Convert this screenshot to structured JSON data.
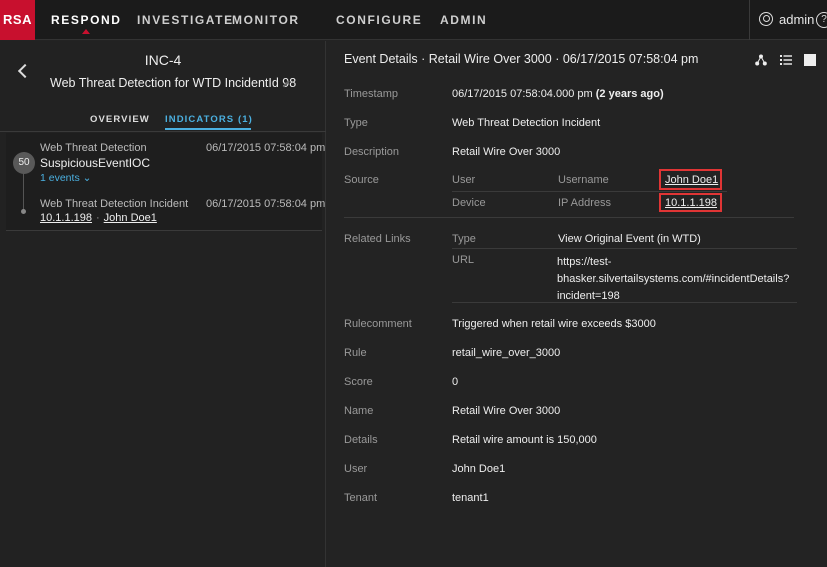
{
  "nav": {
    "logo": "RSA",
    "items": [
      "RESPOND",
      "INVESTIGATE",
      "MONITOR",
      "CONFIGURE",
      "ADMIN"
    ],
    "active": "RESPOND",
    "user": "admin",
    "help_glyph": "?"
  },
  "incident": {
    "id": "INC-4",
    "title": "Web Threat Detection for WTD IncidentId 98",
    "tabs": [
      "OVERVIEW",
      "INDICATORS (1)"
    ],
    "active_tab": "INDICATORS (1)"
  },
  "indicator": {
    "badge": "50",
    "source": "Web Threat Detection",
    "time": "06/17/2015 07:58:04 pm",
    "name": "SuspiciousEventIOC",
    "events_label": "1 events ⌄",
    "event": {
      "type": "Web Threat Detection Incident",
      "time": "06/17/2015 07:58:04 pm",
      "ip": "10.1.1.198",
      "user": "John Doe1",
      "sep": "·"
    }
  },
  "details": {
    "title": "Event Details · Retail Wire Over 3000 · 06/17/2015 07:58:04 pm",
    "timestamp_label": "Timestamp",
    "timestamp_value": "06/17/2015 07:58:04.000 pm",
    "timestamp_rel": "(2 years ago)",
    "type_label": "Type",
    "type_value": "Web Threat Detection Incident",
    "description_label": "Description",
    "description_value": "Retail Wire Over 3000",
    "source_label": "Source",
    "source": {
      "user_label": "User",
      "username_label": "Username",
      "username_value": "John Doe1",
      "device_label": "Device",
      "ip_label": "IP Address",
      "ip_value": "10.1.1.198"
    },
    "related_label": "Related Links",
    "related": {
      "type_label": "Type",
      "type_value": "View Original Event (in WTD)",
      "url_label": "URL",
      "url_value": "https://test-bhasker.silvertailsystems.com/#incidentDetails?incident=198"
    },
    "rulecomment_label": "Rulecomment",
    "rulecomment_value": "Triggered when retail wire exceeds $3000",
    "rule_label": "Rule",
    "rule_value": "retail_wire_over_3000",
    "score_label": "Score",
    "score_value": "0",
    "name_label": "Name",
    "name_value": "Retail Wire Over 3000",
    "details_label": "Details",
    "details_value": "Retail wire amount is 150,000",
    "user_label": "User",
    "user_value": "John Doe1",
    "tenant_label": "Tenant",
    "tenant_value": "tenant1"
  },
  "colors": {
    "accent": "#4bb0e0",
    "brand": "#c8102e",
    "highlight": "#e03535"
  }
}
